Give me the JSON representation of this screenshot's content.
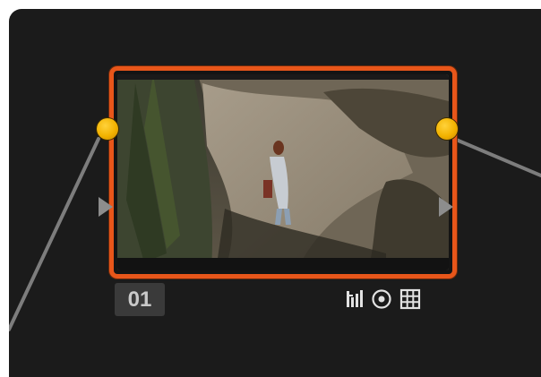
{
  "node": {
    "label": "01",
    "border_color": "#e8561a",
    "port_color": "#f2b200",
    "input_arrow": "play-triangle",
    "output_arrow": "play-triangle"
  },
  "tools": [
    {
      "icon": "curves-icon"
    },
    {
      "icon": "qualifier-circle-icon"
    },
    {
      "icon": "grid-window-icon"
    }
  ],
  "canvas": {
    "background": "#1b1b1b",
    "wire_color": "#8a8a8a"
  }
}
